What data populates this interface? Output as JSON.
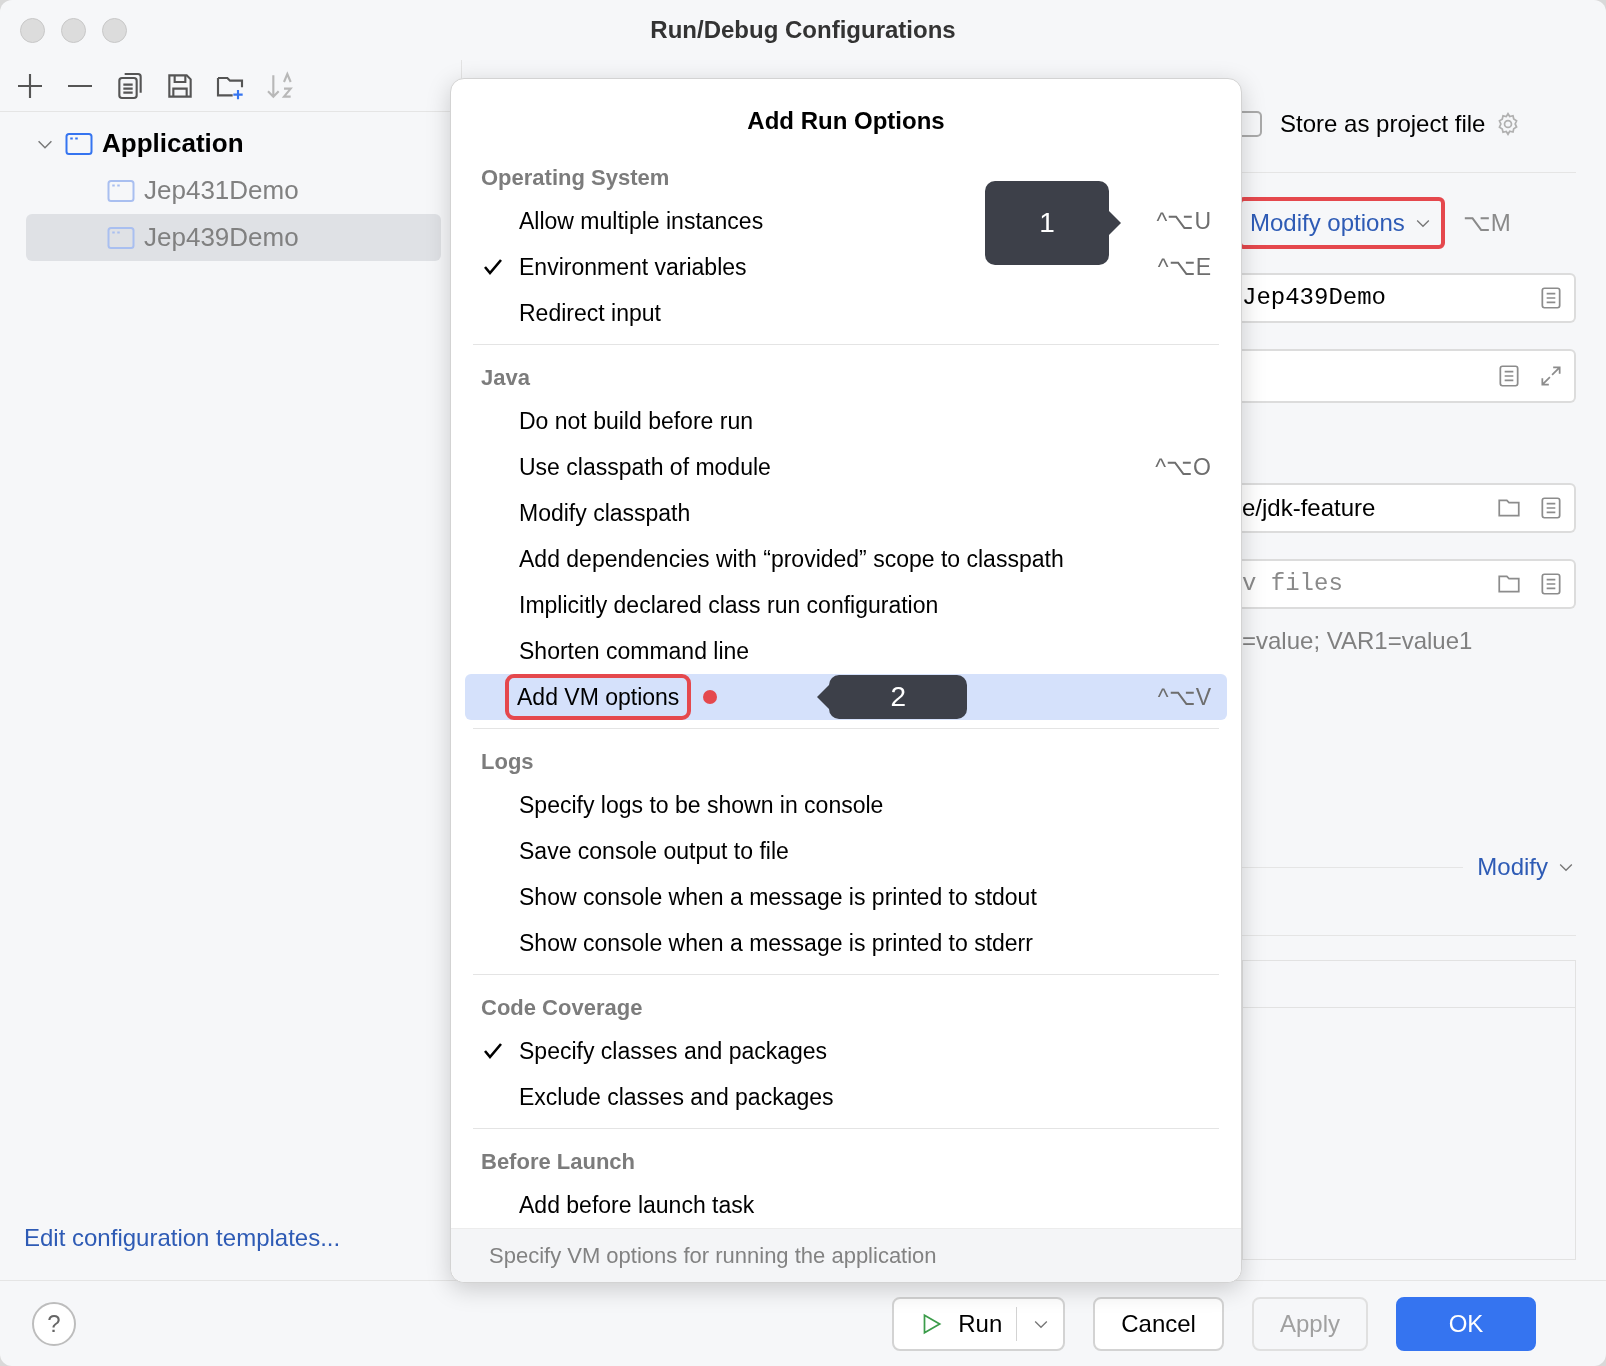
{
  "window": {
    "title": "Run/Debug Configurations"
  },
  "toolbar": [
    {
      "kind": "add",
      "disabled": false
    },
    {
      "kind": "remove",
      "disabled": false
    },
    {
      "kind": "copy",
      "disabled": false
    },
    {
      "kind": "save",
      "disabled": false
    },
    {
      "kind": "new-folder",
      "disabled": false
    },
    {
      "kind": "sort",
      "disabled": true
    }
  ],
  "tree": [
    {
      "label": "Application",
      "expanded": true,
      "selected": false,
      "children": [
        {
          "label": "Jep431Demo",
          "selected": false
        },
        {
          "label": "Jep439Demo",
          "selected": true
        }
      ]
    }
  ],
  "templates_link": "Edit configuration templates...",
  "popup": {
    "title": "Add Run Options",
    "sections": [
      {
        "title": "Operating System",
        "items": [
          {
            "label": "Allow multiple instances",
            "checked": false,
            "selected": false,
            "shortcut": "^⌥U"
          },
          {
            "label": "Environment variables",
            "checked": true,
            "selected": false,
            "shortcut": "^⌥E"
          },
          {
            "label": "Redirect input",
            "checked": false,
            "selected": false
          }
        ]
      },
      {
        "title": "Java",
        "items": [
          {
            "label": "Do not build before run",
            "checked": false,
            "selected": false
          },
          {
            "label": "Use classpath of module",
            "checked": false,
            "selected": false,
            "shortcut": "^⌥O"
          },
          {
            "label": "Modify classpath",
            "checked": false,
            "selected": false
          },
          {
            "label": "Add dependencies with “provided” scope to classpath",
            "checked": false,
            "selected": false
          },
          {
            "label": "Implicitly declared class run configuration",
            "checked": false,
            "selected": false
          },
          {
            "label": "Shorten command line",
            "checked": false,
            "selected": false
          },
          {
            "label": "Add VM options",
            "checked": false,
            "selected": true,
            "shortcut": "^⌥V",
            "callout": "2"
          }
        ]
      },
      {
        "title": "Logs",
        "items": [
          {
            "label": "Specify logs to be shown in console",
            "checked": false,
            "selected": false
          },
          {
            "label": "Save console output to file",
            "checked": false,
            "selected": false
          },
          {
            "label": "Show console when a message is printed to stdout",
            "checked": false,
            "selected": false
          },
          {
            "label": "Show console when a message is printed to stderr",
            "checked": false,
            "selected": false
          }
        ]
      },
      {
        "title": "Code Coverage",
        "items": [
          {
            "label": "Specify classes and packages",
            "checked": true,
            "selected": false
          },
          {
            "label": "Exclude classes and packages",
            "checked": false,
            "selected": false
          }
        ]
      },
      {
        "title": "Before Launch",
        "items": [
          {
            "label": "Add before launch task",
            "checked": false,
            "selected": false
          }
        ]
      }
    ],
    "footer": "Specify VM options for running the application"
  },
  "right_panel": {
    "store_as_project_file": {
      "label": "Store as project file",
      "checked": false
    },
    "modify_options": {
      "label": "Modify options",
      "shortcut": "⌥M",
      "callout": "1"
    },
    "fields": [
      {
        "kind": "mono",
        "value": "Jep439Demo",
        "icons": [
          {
            "kind": "doc"
          }
        ]
      },
      {
        "kind": "text",
        "icons": [
          {
            "kind": "doc"
          },
          {
            "kind": "expand"
          }
        ]
      },
      {
        "kind": "text",
        "value": "e/jdk-feature",
        "icons": [
          {
            "kind": "folder"
          },
          {
            "kind": "doc"
          }
        ]
      },
      {
        "kind": "mono",
        "placeholder": "v files",
        "icons": [
          {
            "kind": "folder"
          },
          {
            "kind": "doc"
          }
        ]
      }
    ],
    "hint": "=value; VAR1=value1",
    "modify_link": "Modify"
  },
  "help_button": "?",
  "buttons": [
    {
      "label": "Run",
      "kind": "run",
      "disabled": false
    },
    {
      "label": "Cancel",
      "kind": "default",
      "disabled": false
    },
    {
      "label": "Apply",
      "kind": "default",
      "disabled": true
    },
    {
      "label": "OK",
      "kind": "primary",
      "disabled": false
    }
  ]
}
